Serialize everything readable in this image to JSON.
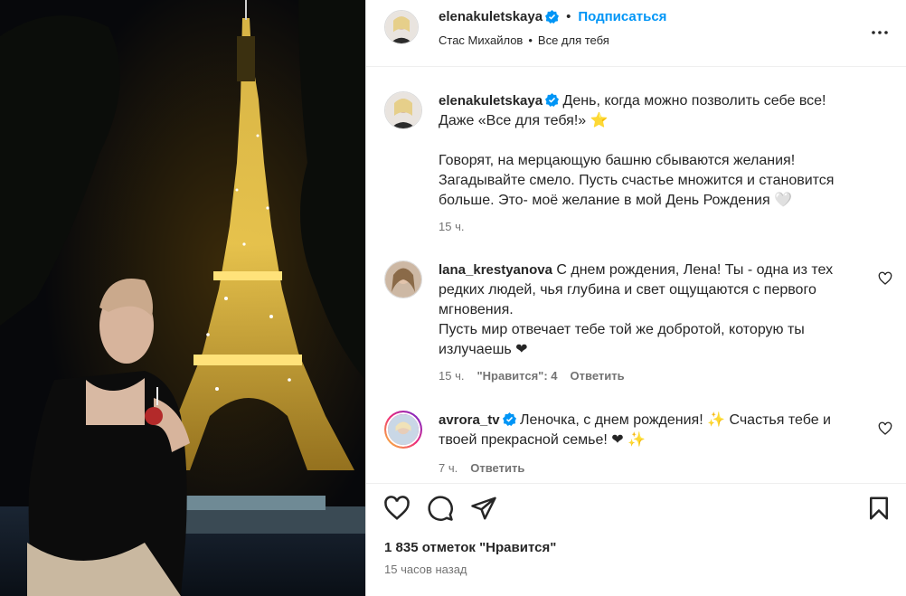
{
  "post": {
    "author": "elenakuletskaya",
    "follow_label": "Подписаться",
    "separator": "•",
    "audio_artist": "Стас Михайлов",
    "audio_track": "Все для тебя"
  },
  "caption": {
    "username": "elenakuletskaya",
    "line1": "День, когда можно позволить себе все!",
    "line2": "Даже «Все для тебя!» ⭐",
    "line3": "Говорят, на мерцающую башню сбываются желания!",
    "line4": "Загадывайте смело. Пусть счастье множится и становится",
    "line5": "больше. Это- моё желание в мой День Рождения 🤍",
    "time": "15 ч."
  },
  "comments": [
    {
      "username": "lana_krestyanova",
      "line1": "С днем рождения, Лена! Ты - одна из тех",
      "line2": "редких людей, чья глубина и свет ощущаются с первого",
      "line3": "мгновения.",
      "line4": "Пусть мир отвечает тебе той же добротой, которую ты",
      "line5": "излучаешь ❤",
      "time": "15 ч.",
      "likes": "\"Нравится\": 4",
      "reply": "Ответить"
    },
    {
      "username": "avrora_tv",
      "line1": "Леночка, с днем рождения! ✨  Счастья тебе и",
      "line2": "твоей прекрасной семье! ❤ ✨",
      "time": "7 ч.",
      "reply": "Ответить"
    }
  ],
  "footer": {
    "likes_count": "1 835 отметок \"Нравится\"",
    "posted_ago": "15 часов назад"
  },
  "colors": {
    "accent": "#0095f6",
    "verified": "#0095f6",
    "muted": "#737373",
    "heart_red": "#ff3040"
  },
  "icons": [
    "verified-badge-icon",
    "more-options-icon",
    "heart-icon",
    "comment-icon",
    "share-icon",
    "bookmark-icon"
  ]
}
